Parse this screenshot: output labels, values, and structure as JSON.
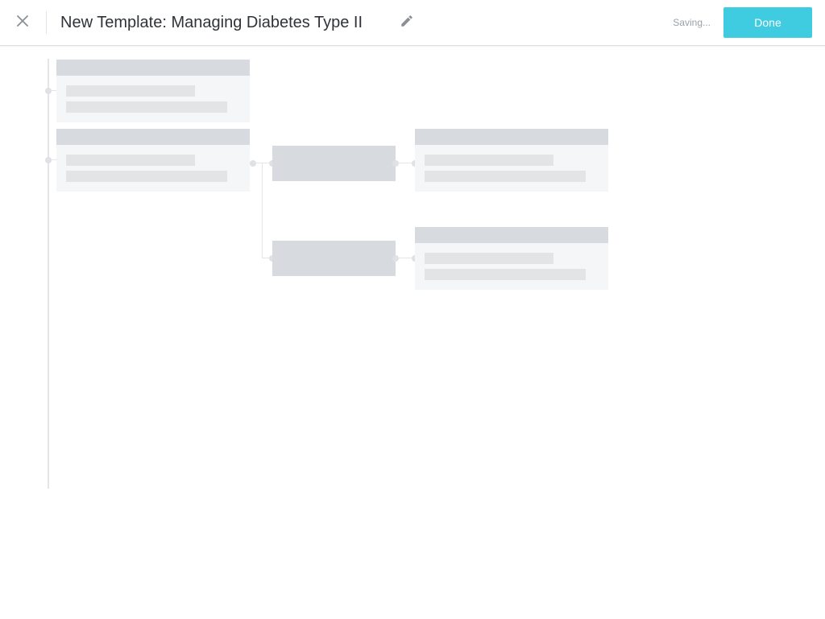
{
  "header": {
    "title": "New Template: Managing Diabetes Type II",
    "status": "Saving...",
    "done_label": "Done"
  },
  "icons": {
    "close": "close-icon",
    "edit": "pencil-icon"
  },
  "colors": {
    "accent": "#3fcbe0",
    "placeholder_header": "#d7dbdf",
    "placeholder_body": "#f5f6f7",
    "placeholder_line": "#e3e4e6",
    "title_text": "#2f3338",
    "muted_text": "#9aa0a6"
  }
}
